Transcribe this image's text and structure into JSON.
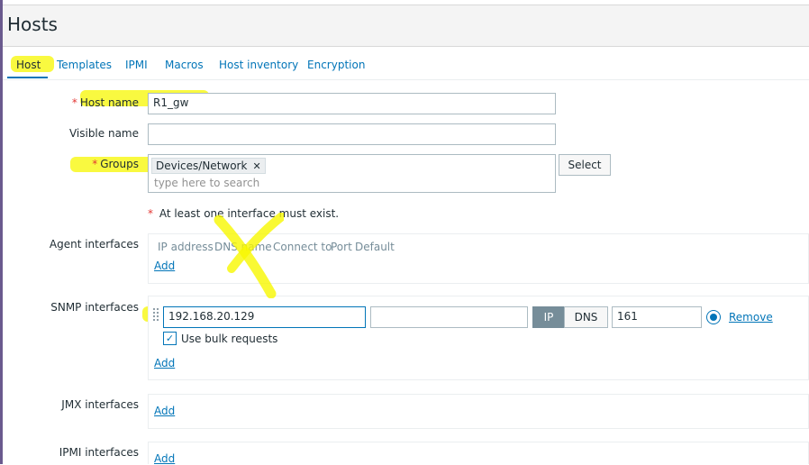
{
  "header": {
    "title": "Hosts"
  },
  "tabs": [
    {
      "label": "Host",
      "active": true
    },
    {
      "label": "Templates"
    },
    {
      "label": "IPMI"
    },
    {
      "label": "Macros"
    },
    {
      "label": "Host inventory"
    },
    {
      "label": "Encryption"
    }
  ],
  "form": {
    "host_name_label": "Host name",
    "host_name_value": "R1_gw",
    "visible_name_label": "Visible name",
    "visible_name_value": "",
    "groups_label": "Groups",
    "groups_chip": "Devices/Network",
    "groups_placeholder": "type here to search",
    "select_button": "Select",
    "interface_note": "At least one interface must exist.",
    "required_marker": "*"
  },
  "agent": {
    "label": "Agent interfaces",
    "columns": [
      "IP address",
      "DNS name",
      "Connect to",
      "Port",
      "Default"
    ],
    "add_link": "Add"
  },
  "snmp": {
    "label": "SNMP interfaces",
    "ip_value": "192.168.20.129",
    "dns_value": "",
    "connect_ip": "IP",
    "connect_dns": "DNS",
    "port_value": "161",
    "default_selected": true,
    "remove_link": "Remove",
    "bulk_label": "Use bulk requests",
    "bulk_checked": true,
    "add_link": "Add"
  },
  "jmx": {
    "label": "JMX interfaces",
    "add_link": "Add"
  },
  "ipmi": {
    "label": "IPMI interfaces",
    "add_link": "Add"
  },
  "colors": {
    "link": "#0275b8",
    "required": "#e33734",
    "highlight": "#f7f700",
    "seg_active": "#768d99"
  }
}
